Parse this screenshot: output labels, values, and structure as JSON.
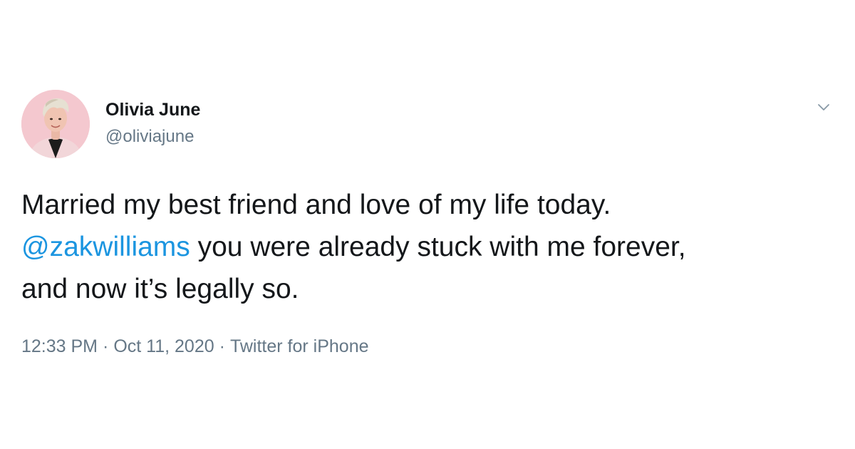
{
  "author": {
    "display_name": "Olivia June",
    "handle": "@oliviajune",
    "avatar_icon": "profile-photo"
  },
  "tweet": {
    "line1": "Married my best friend and love of my life today.",
    "mention": "@zakwilliams",
    "line2_rest": " you were already stuck with me forever,",
    "line3": "and now it’s legally so."
  },
  "meta": {
    "time": "12:33 PM",
    "separator": "·",
    "date": "Oct 11, 2020",
    "source": "Twitter for iPhone"
  },
  "menu": {
    "icon": "chevron-down-icon"
  },
  "colors": {
    "text": "#14171a",
    "secondary": "#657786",
    "mention": "#1b95e0",
    "background": "#ffffff"
  }
}
